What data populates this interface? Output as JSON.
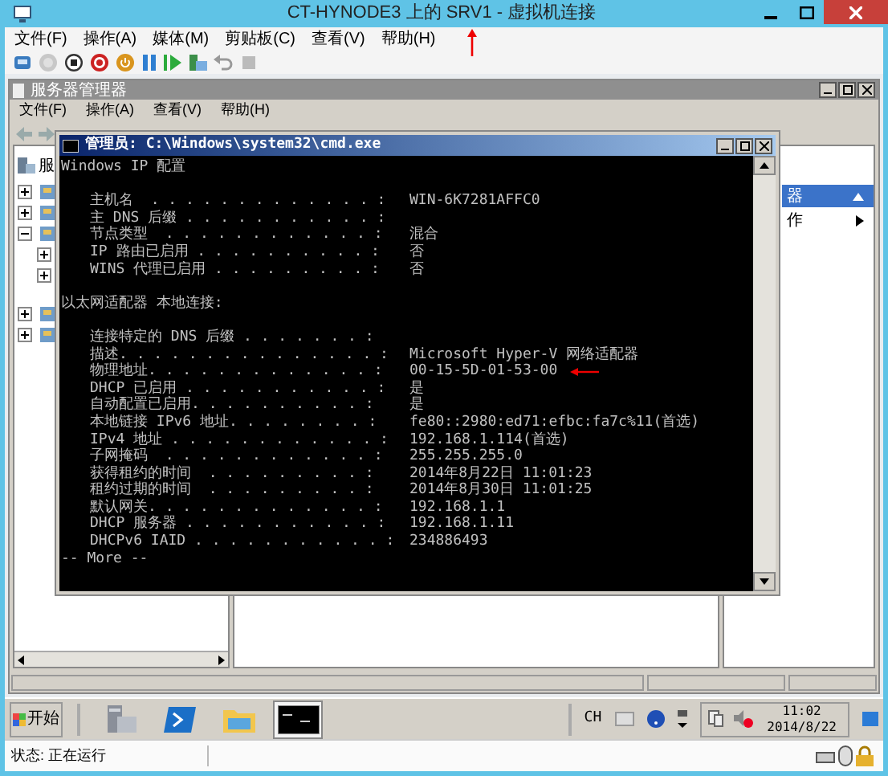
{
  "window": {
    "title": "CT-HYNODE3 上的 SRV1 - 虚拟机连接"
  },
  "menu": [
    "文件(F)",
    "操作(A)",
    "媒体(M)",
    "剪贴板(C)",
    "查看(V)",
    "帮助(H)"
  ],
  "server_manager": {
    "title": "服务器管理器",
    "menu": [
      "文件(F)",
      "操作(A)",
      "查看(V)",
      "帮助(H)"
    ],
    "tree_header": "服",
    "tree": [
      {
        "expanded": false
      },
      {
        "expanded": false
      },
      {
        "expanded": true,
        "children": [
          {
            "expanded": false
          },
          {
            "expanded": false
          }
        ]
      },
      {
        "expanded": false
      },
      {
        "expanded": false
      }
    ],
    "actions_header": "器",
    "actions": [
      "作"
    ]
  },
  "cmd": {
    "title": "管理员: C:\\Windows\\system32\\cmd.exe",
    "heading": "Windows IP 配置",
    "sections": [
      {
        "entries": [
          {
            "label": "主机名  . . . . . . . . . . . . . :",
            "value": "WIN-6K7281AFFC0",
            "annotated": false
          },
          {
            "label": "主 DNS 后缀 . . . . . . . . . . . :",
            "annotated": false
          },
          {
            "label": "节点类型  . . . . . . . . . . . . :",
            "value": "混合",
            "annotated": false
          },
          {
            "label": "IP 路由已启用 . . . . . . . . . . :",
            "value": "否",
            "annotated": false
          },
          {
            "label": "WINS 代理已启用 . . . . . . . . . :",
            "value": "否",
            "annotated": false
          }
        ]
      },
      {
        "heading": "以太网适配器 本地连接:",
        "entries": [
          {
            "label": "连接特定的 DNS 后缀 . . . . . . . :",
            "annotated": false
          },
          {
            "label": "描述. . . . . . . . . . . . . . . :",
            "value": "Microsoft Hyper-V 网络适配器",
            "annotated": false
          },
          {
            "label": "物理地址. . . . . . . . . . . . . :",
            "value": "00-15-5D-01-53-00",
            "annotated": true
          },
          {
            "label": "DHCP 已启用 . . . . . . . . . . . :",
            "value": "是",
            "annotated": false
          },
          {
            "label": "自动配置已启用. . . . . . . . . . :",
            "value": "是",
            "annotated": false
          },
          {
            "label": "本地链接 IPv6 地址. . . . . . . . :",
            "value": "fe80::2980:ed71:efbc:fa7c%11(首选)",
            "annotated": false
          },
          {
            "label": "IPv4 地址 . . . . . . . . . . . . :",
            "value": "192.168.1.114(首选)",
            "annotated": false
          },
          {
            "label": "子网掩码  . . . . . . . . . . . . :",
            "value": "255.255.255.0",
            "annotated": false
          },
          {
            "label": "获得租约的时间  . . . . . . . . . :",
            "value": "2014年8月22日 11:01:23",
            "annotated": false
          },
          {
            "label": "租约过期的时间  . . . . . . . . . :",
            "value": "2014年8月30日 11:01:25",
            "annotated": false
          },
          {
            "label": "默认网关. . . . . . . . . . . . . :",
            "value": "192.168.1.1",
            "annotated": false
          },
          {
            "label": "DHCP 服务器 . . . . . . . . . . . :",
            "value": "192.168.1.11",
            "annotated": false
          },
          {
            "label": "DHCPv6 IAID . . . . . . . . . . . :",
            "value": "234886493",
            "annotated": false
          }
        ]
      }
    ],
    "footer": "-- More --"
  },
  "taskbar": {
    "start": "开始",
    "apps": [
      {
        "kind": "server",
        "selected": false
      },
      {
        "kind": "shell",
        "selected": false
      },
      {
        "kind": "folder",
        "selected": false
      },
      {
        "kind": "console",
        "selected": true
      }
    ],
    "language": "CH",
    "time": "11:02",
    "date": "2014/8/22"
  },
  "status_bar": {
    "text": "状态: 正在运行"
  }
}
